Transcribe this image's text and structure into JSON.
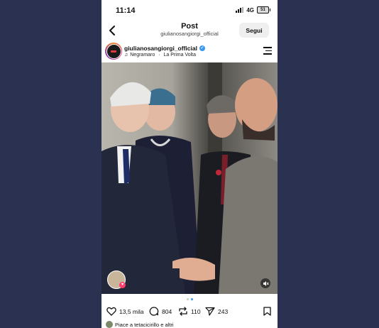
{
  "status_bar": {
    "time": "11:14",
    "network": "4G",
    "battery": "51"
  },
  "header": {
    "title": "Post",
    "subtitle": "giulianosangiorgi_official",
    "follow_label": "Segui"
  },
  "author": {
    "username": "giulianosangiorgi_official",
    "verified": true,
    "music_artist": "Negramaro",
    "music_separator": " · ",
    "music_song": "La Prima Volta"
  },
  "carousel": {
    "total": 2,
    "active_index": 1
  },
  "actions": {
    "likes": "13,5 mila",
    "comments": "804",
    "reposts": "110",
    "shares": "243"
  },
  "liked_by": {
    "text": "Piace a tetacicirillo e altri"
  },
  "colors": {
    "accent": "#3897f0",
    "heart": "#ff3d6e",
    "background": "#2b3150"
  }
}
